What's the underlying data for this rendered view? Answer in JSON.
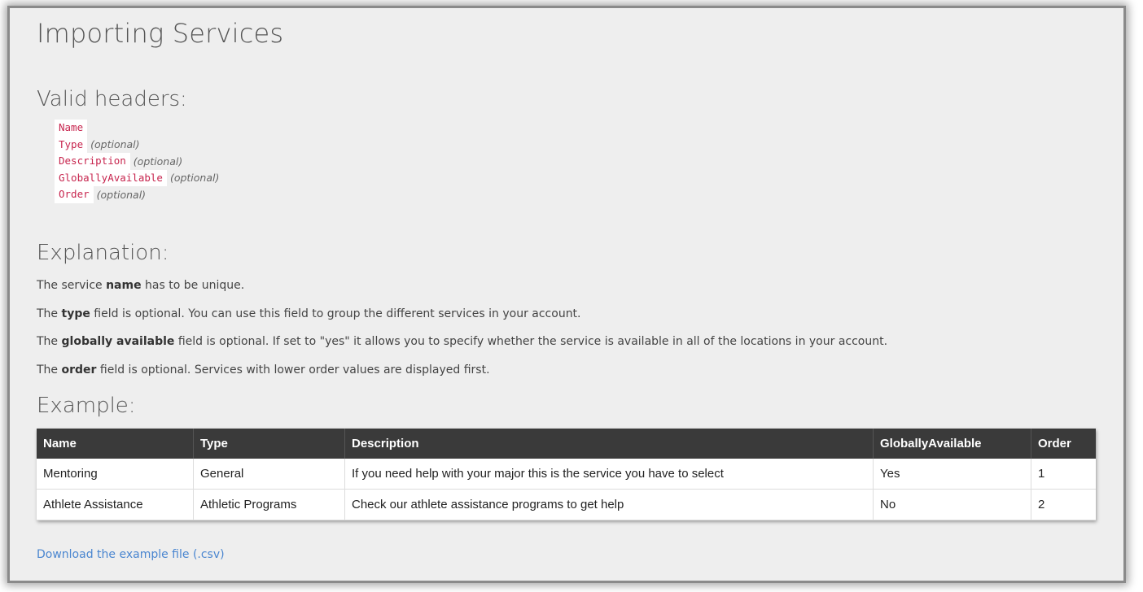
{
  "page": {
    "title": "Importing Services"
  },
  "valid_headers": {
    "heading": "Valid headers:",
    "items": [
      {
        "code": "Name",
        "note": ""
      },
      {
        "code": "Type",
        "note": "(optional)"
      },
      {
        "code": "Description",
        "note": "(optional)"
      },
      {
        "code": "GloballyAvailable",
        "note": "(optional)"
      },
      {
        "code": "Order",
        "note": "(optional)"
      }
    ]
  },
  "explanation": {
    "heading": "Explanation:",
    "lines": [
      {
        "pre": "The service ",
        "bold": "name",
        "post": " has to be unique."
      },
      {
        "pre": "The ",
        "bold": "type",
        "post": " field is optional. You can use this field to group the different services in your account."
      },
      {
        "pre": "The ",
        "bold": "globally available",
        "post": " field is optional. If set to \"yes\" it allows you to specify whether the service is available in all of the locations in your account."
      },
      {
        "pre": "The ",
        "bold": "order",
        "post": " field is optional. Services with lower order values are displayed first."
      }
    ]
  },
  "example": {
    "heading": "Example:",
    "columns": [
      "Name",
      "Type",
      "Description",
      "GloballyAvailable",
      "Order"
    ],
    "rows": [
      [
        "Mentoring",
        "General",
        "If you need help with your major this is the service you have to select",
        "Yes",
        "1"
      ],
      [
        "Athlete Assistance",
        "Athletic Programs",
        "Check our athlete assistance programs to get help",
        "No",
        "2"
      ]
    ]
  },
  "download": {
    "label": "Download the example file (.csv)"
  },
  "colors": {
    "background": "#eeeeee",
    "code_text": "#c7254e",
    "table_header": "#3a3a3a",
    "link": "#4a86d0"
  }
}
